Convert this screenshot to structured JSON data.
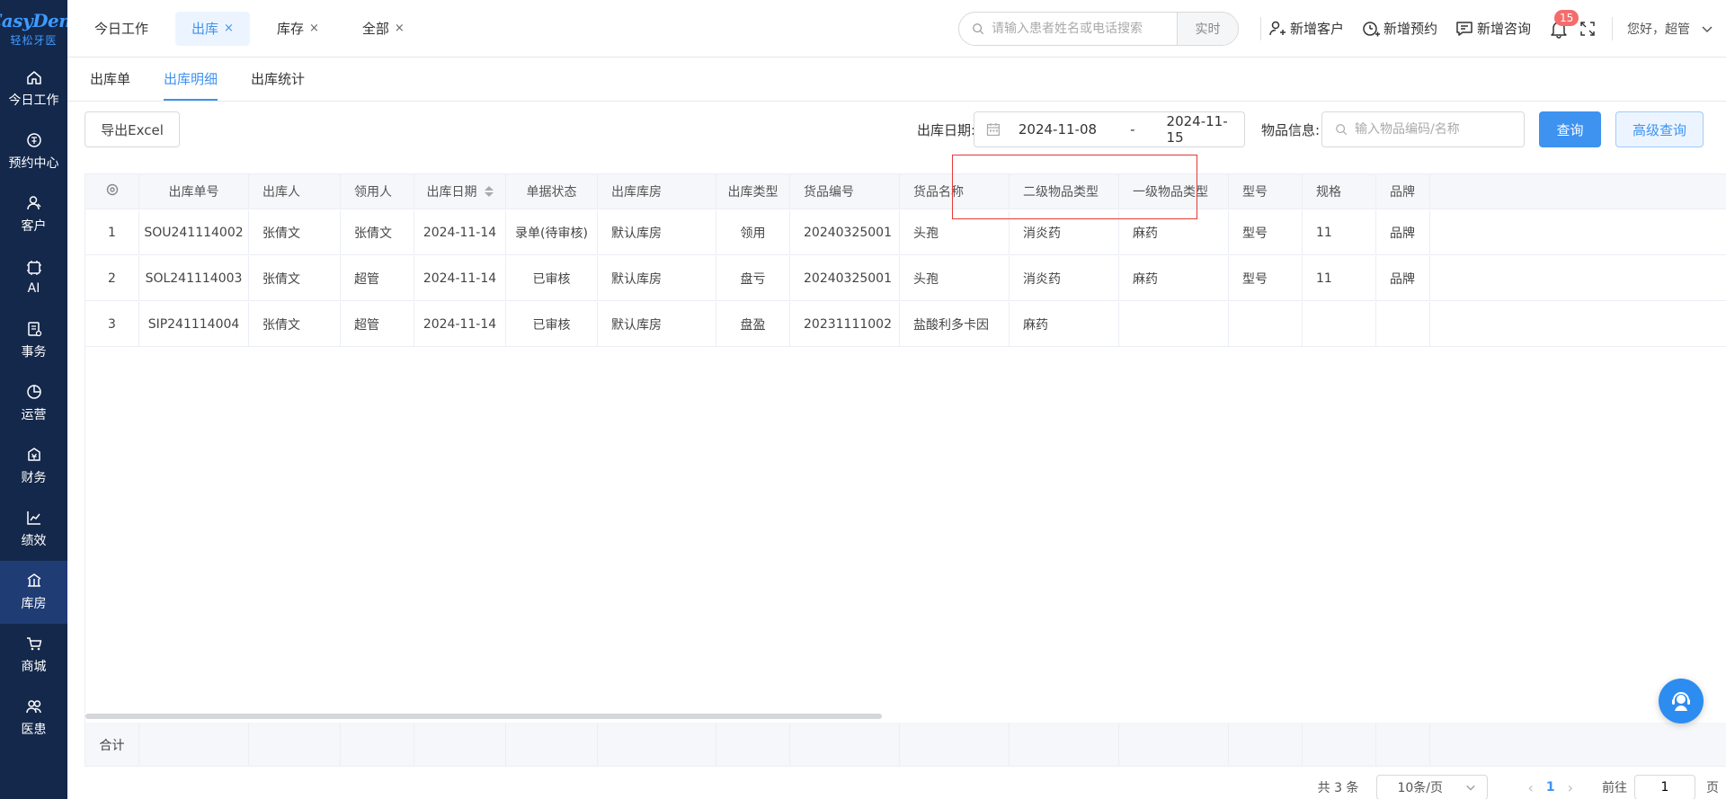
{
  "logo": {
    "main": "EasyDent",
    "sub": "轻松牙医"
  },
  "sidebar": {
    "items": [
      {
        "label": "今日工作",
        "icon": "home-icon",
        "active": false
      },
      {
        "label": "预约中心",
        "icon": "appointment-icon",
        "active": false
      },
      {
        "label": "客户",
        "icon": "customer-icon",
        "active": false
      },
      {
        "label": "AI",
        "icon": "ai-chip-icon",
        "active": false
      },
      {
        "label": "事务",
        "icon": "task-icon",
        "active": false
      },
      {
        "label": "运营",
        "icon": "pie-chart-icon",
        "active": false
      },
      {
        "label": "财务",
        "icon": "finance-icon",
        "active": false
      },
      {
        "label": "绩效",
        "icon": "trend-icon",
        "active": false
      },
      {
        "label": "库房",
        "icon": "warehouse-icon",
        "active": true
      },
      {
        "label": "商城",
        "icon": "cart-icon",
        "active": false
      },
      {
        "label": "医患",
        "icon": "doctor-patient-icon",
        "active": false
      }
    ]
  },
  "header": {
    "tabs": [
      {
        "label": "今日工作",
        "closable": false,
        "active": false
      },
      {
        "label": "出库",
        "closable": true,
        "active": true
      },
      {
        "label": "库存",
        "closable": true,
        "active": false
      },
      {
        "label": "全部",
        "closable": true,
        "active": false
      }
    ],
    "close_glyph": "×",
    "search_placeholder": "请输入患者姓名或电话搜索",
    "realtime_label": "实时",
    "add_customer": "新增客户",
    "add_appointment": "新增预约",
    "add_consult": "新增咨询",
    "notification_count": "15",
    "greeting": "您好，超管"
  },
  "subtabs": [
    {
      "label": "出库单",
      "active": false
    },
    {
      "label": "出库明细",
      "active": true
    },
    {
      "label": "出库统计",
      "active": false
    }
  ],
  "toolbar": {
    "export_label": "导出Excel",
    "date_label": "出库日期:",
    "date_start": "2024-11-08",
    "date_sep": "-",
    "date_end": "2024-11-15",
    "item_label": "物品信息:",
    "item_placeholder": "输入物品编码/名称",
    "query_label": "查询",
    "advanced_label": "高级查询"
  },
  "table": {
    "columns": [
      "出库单号",
      "出库人",
      "领用人",
      "出库日期",
      "单据状态",
      "出库库房",
      "出库类型",
      "货品编号",
      "货品名称",
      "二级物品类型",
      "一级物品类型",
      "型号",
      "规格",
      "品牌"
    ],
    "rows": [
      [
        "1",
        "SOU241114002",
        "张倩文",
        "张倩文",
        "2024-11-14",
        "录单(待审核)",
        "默认库房",
        "领用",
        "20240325001",
        "头孢",
        "消炎药",
        "麻药",
        "型号",
        "11",
        "品牌"
      ],
      [
        "2",
        "SOL241114003",
        "张倩文",
        "超管",
        "2024-11-14",
        "已审核",
        "默认库房",
        "盘亏",
        "20240325001",
        "头孢",
        "消炎药",
        "麻药",
        "型号",
        "11",
        "品牌"
      ],
      [
        "3",
        "SIP241114004",
        "张倩文",
        "超管",
        "2024-11-14",
        "已审核",
        "默认库房",
        "盘盈",
        "20231111002",
        "盐酸利多卡因",
        "麻药",
        "",
        "",
        "",
        ""
      ]
    ],
    "summary_label": "合计"
  },
  "pagination": {
    "total": "共 3 条",
    "page_size": "10条/页",
    "prev": "‹",
    "current": "1",
    "next": "›",
    "goto_label": "前往",
    "page_value": "1",
    "page_suffix": "页"
  },
  "colors": {
    "sidebar_bg": "#14284b",
    "accent": "#3e92f0",
    "highlight": "#e53935"
  }
}
